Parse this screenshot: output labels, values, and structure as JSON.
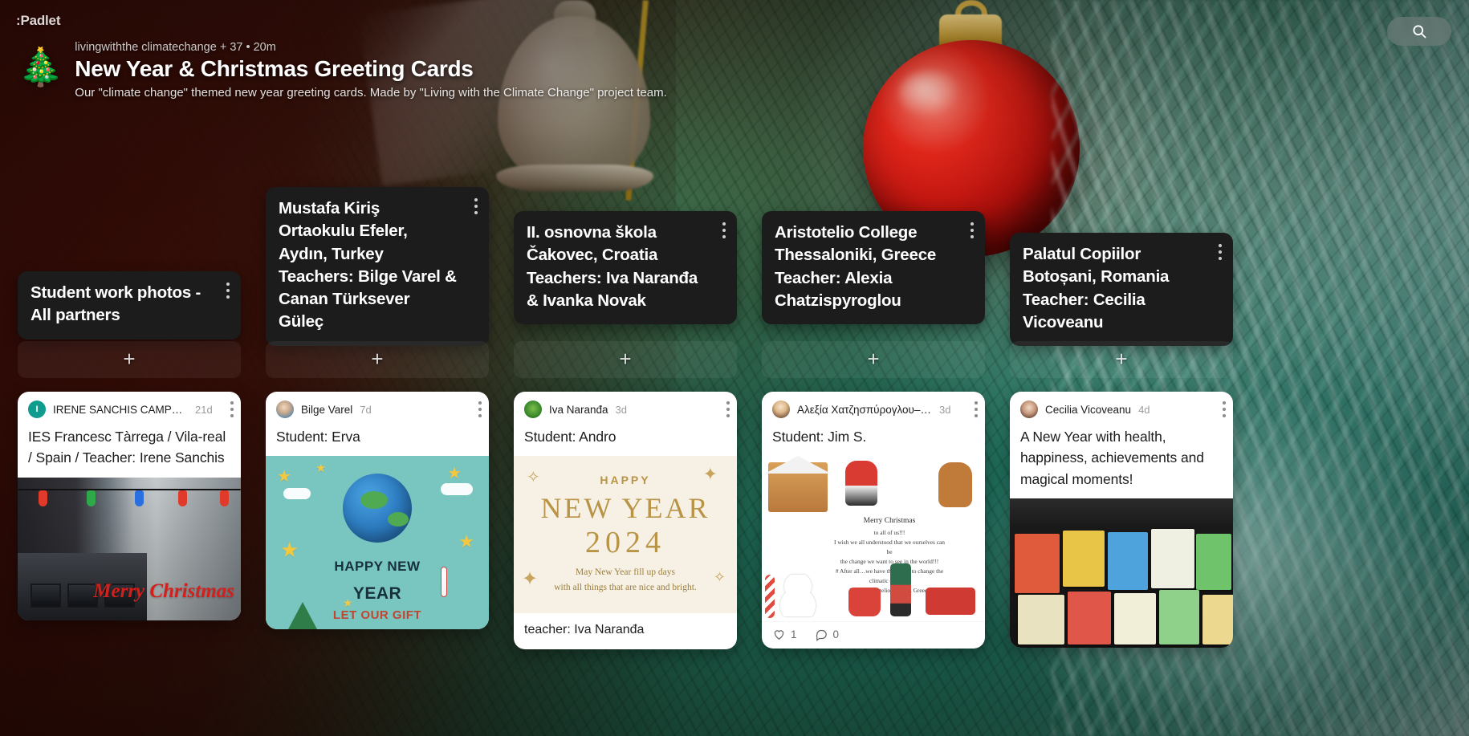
{
  "app": {
    "logo_text": ":Padlet",
    "search_icon": "search-icon"
  },
  "board": {
    "emoji": "🎄",
    "meta": "livingwiththe climatechange + 37  •  20m",
    "title": "New Year & Christmas Greeting Cards",
    "description": "Our \"climate change\" themed new year greeting cards. Made by \"Living with the Climate Change\" project team."
  },
  "add_label": "+",
  "columns": [
    {
      "id": "col-student-work",
      "title": "Student work photos - All partners",
      "menu_icon": "kebab-menu-icon",
      "add_label": "+",
      "post": {
        "author": "IRENE SANCHIS CAMPRE…",
        "avatar_initial": "I",
        "avatar_type": "initial",
        "time": "21d",
        "body": "IES Francesc Tàrrega / Vila-real / Spain / Teacher: Irene Sanchis",
        "media": "classroom-photo",
        "media_text": "Merry Christmas",
        "caption": "",
        "actions": null
      }
    },
    {
      "id": "col-mustafa-kiris",
      "title": "Mustafa Kiriş Ortaokulu Efeler, Aydın, Turkey Teachers: Bilge Varel & Canan Türksever Güleç",
      "menu_icon": "kebab-menu-icon",
      "add_label": "+",
      "post": {
        "author": "Bilge Varel",
        "avatar_initial": "B",
        "avatar_type": "photo",
        "time": "7d",
        "body": "Student: Erva",
        "media": "earth-new-year-card",
        "media_lines": [
          "HAPPY NEW",
          "YEAR",
          "LET OUR GIFT"
        ],
        "caption": "",
        "actions": null
      }
    },
    {
      "id": "col-ii-osnovna-skola",
      "title": "II. osnovna škola Čakovec, Croatia Teachers: Iva Naranđa & Ivanka Novak",
      "menu_icon": "kebab-menu-icon",
      "add_label": "+",
      "post": {
        "author": "Iva Naranđa",
        "avatar_initial": "I",
        "avatar_type": "photo",
        "time": "3d",
        "body": "Student: Andro",
        "media": "happy-new-year-2024-card",
        "media_lines": [
          "HAPPY",
          "NEW YEAR",
          "2024",
          "May New Year fill up days",
          "with all things that are nice and bright."
        ],
        "caption": "teacher: Iva Naranđa",
        "actions": null
      }
    },
    {
      "id": "col-aristotelio-college",
      "title": "Aristotelio College Thessaloniki, Greece Teacher: Alexia Chatzispyroglou",
      "menu_icon": "kebab-menu-icon",
      "add_label": "+",
      "post": {
        "author": "Αλεξία Χατζησπύρογλου–Σ…",
        "avatar_initial": "Α",
        "avatar_type": "photo",
        "time": "3d",
        "body": "Student: Jim S.",
        "media": "christmas-greeting-card",
        "media_title": "Merry Christmas",
        "media_lines": [
          "to all of us!!!",
          "I wish we all understood that we ourselves can be",
          "the change we want to see in the world!!!",
          "# After all…we have the power to change the",
          "climatic change#",
          "Jim S. Aristotelio College, Greece"
        ],
        "caption": "",
        "actions": {
          "like_icon": "heart-icon",
          "like_count": "1",
          "comment_icon": "comment-icon",
          "comment_count": "0"
        }
      }
    },
    {
      "id": "col-palatul-copiilor",
      "title": "Palatul Copiilor Botoșani, Romania Teacher: Cecilia Vicoveanu",
      "menu_icon": "kebab-menu-icon",
      "add_label": "+",
      "post": {
        "author": "Cecilia Vicoveanu",
        "avatar_initial": "C",
        "avatar_type": "photo",
        "time": "4d",
        "body": "A New Year with health, happiness, achievements and magical moments!",
        "media": "handmade-cards-photo",
        "caption": "",
        "actions": null
      }
    }
  ]
}
